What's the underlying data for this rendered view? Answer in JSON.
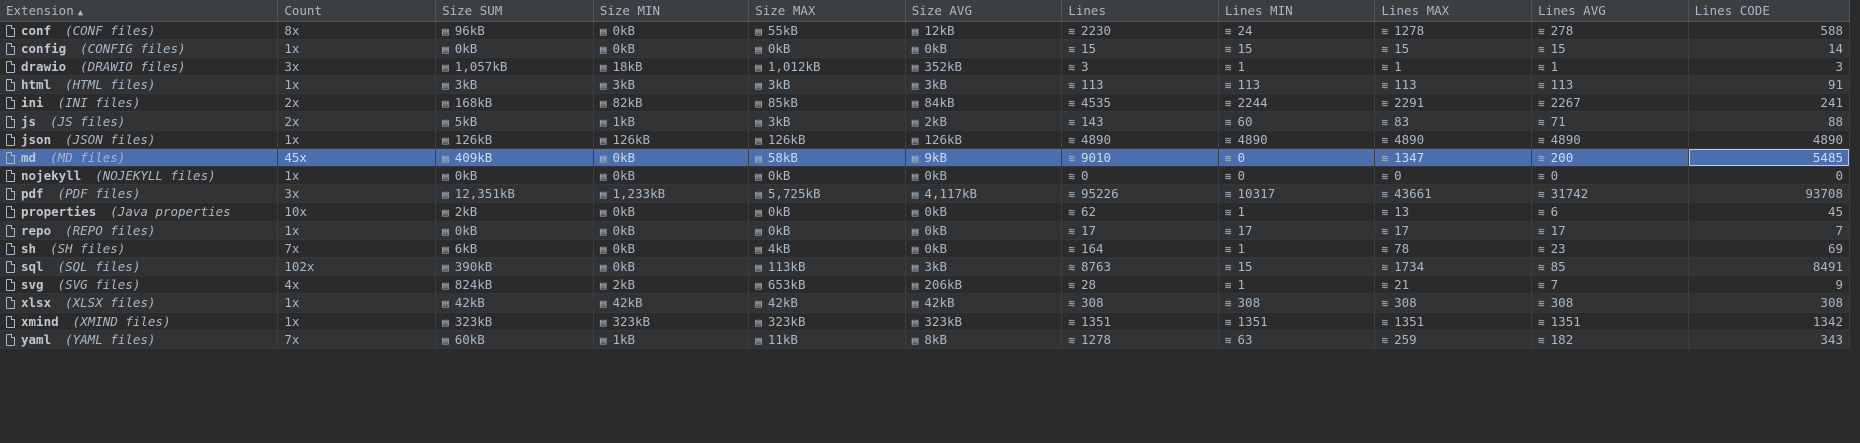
{
  "columns": [
    "Extension",
    "Count",
    "Size SUM",
    "Size MIN",
    "Size MAX",
    "Size AVG",
    "Lines",
    "Lines MIN",
    "Lines MAX",
    "Lines AVG",
    "Lines CODE"
  ],
  "sort": {
    "column": "Extension",
    "direction": "ascending",
    "icon": "sort-ascending-icon"
  },
  "selected_row": "md",
  "rows": [
    {
      "ext": "conf",
      "desc": "(CONF files)",
      "count": "8x",
      "size_sum": "96kB",
      "size_min": "0kB",
      "size_max": "55kB",
      "size_avg": "12kB",
      "lines": "2230",
      "lines_min": "24",
      "lines_max": "1278",
      "lines_avg": "278",
      "lines_code": "588"
    },
    {
      "ext": "config",
      "desc": "(CONFIG files)",
      "count": "1x",
      "size_sum": "0kB",
      "size_min": "0kB",
      "size_max": "0kB",
      "size_avg": "0kB",
      "lines": "15",
      "lines_min": "15",
      "lines_max": "15",
      "lines_avg": "15",
      "lines_code": "14"
    },
    {
      "ext": "drawio",
      "desc": "(DRAWIO files)",
      "count": "3x",
      "size_sum": "1,057kB",
      "size_min": "18kB",
      "size_max": "1,012kB",
      "size_avg": "352kB",
      "lines": "3",
      "lines_min": "1",
      "lines_max": "1",
      "lines_avg": "1",
      "lines_code": "3"
    },
    {
      "ext": "html",
      "desc": "(HTML files)",
      "count": "1x",
      "size_sum": "3kB",
      "size_min": "3kB",
      "size_max": "3kB",
      "size_avg": "3kB",
      "lines": "113",
      "lines_min": "113",
      "lines_max": "113",
      "lines_avg": "113",
      "lines_code": "91"
    },
    {
      "ext": "ini",
      "desc": "(INI files)",
      "count": "2x",
      "size_sum": "168kB",
      "size_min": "82kB",
      "size_max": "85kB",
      "size_avg": "84kB",
      "lines": "4535",
      "lines_min": "2244",
      "lines_max": "2291",
      "lines_avg": "2267",
      "lines_code": "241"
    },
    {
      "ext": "js",
      "desc": "(JS files)",
      "count": "2x",
      "size_sum": "5kB",
      "size_min": "1kB",
      "size_max": "3kB",
      "size_avg": "2kB",
      "lines": "143",
      "lines_min": "60",
      "lines_max": "83",
      "lines_avg": "71",
      "lines_code": "88"
    },
    {
      "ext": "json",
      "desc": "(JSON files)",
      "count": "1x",
      "size_sum": "126kB",
      "size_min": "126kB",
      "size_max": "126kB",
      "size_avg": "126kB",
      "lines": "4890",
      "lines_min": "4890",
      "lines_max": "4890",
      "lines_avg": "4890",
      "lines_code": "4890"
    },
    {
      "ext": "md",
      "desc": "(MD files)",
      "count": "45x",
      "size_sum": "409kB",
      "size_min": "0kB",
      "size_max": "58kB",
      "size_avg": "9kB",
      "lines": "9010",
      "lines_min": "0",
      "lines_max": "1347",
      "lines_avg": "200",
      "lines_code": "5485"
    },
    {
      "ext": "nojekyll",
      "desc": "(NOJEKYLL files)",
      "count": "1x",
      "size_sum": "0kB",
      "size_min": "0kB",
      "size_max": "0kB",
      "size_avg": "0kB",
      "lines": "0",
      "lines_min": "0",
      "lines_max": "0",
      "lines_avg": "0",
      "lines_code": "0"
    },
    {
      "ext": "pdf",
      "desc": "(PDF files)",
      "count": "3x",
      "size_sum": "12,351kB",
      "size_min": "1,233kB",
      "size_max": "5,725kB",
      "size_avg": "4,117kB",
      "lines": "95226",
      "lines_min": "10317",
      "lines_max": "43661",
      "lines_avg": "31742",
      "lines_code": "93708"
    },
    {
      "ext": "properties",
      "desc": "(Java properties",
      "count": "10x",
      "size_sum": "2kB",
      "size_min": "0kB",
      "size_max": "0kB",
      "size_avg": "0kB",
      "lines": "62",
      "lines_min": "1",
      "lines_max": "13",
      "lines_avg": "6",
      "lines_code": "45"
    },
    {
      "ext": "repo",
      "desc": "(REPO files)",
      "count": "1x",
      "size_sum": "0kB",
      "size_min": "0kB",
      "size_max": "0kB",
      "size_avg": "0kB",
      "lines": "17",
      "lines_min": "17",
      "lines_max": "17",
      "lines_avg": "17",
      "lines_code": "7"
    },
    {
      "ext": "sh",
      "desc": "(SH files)",
      "count": "7x",
      "size_sum": "6kB",
      "size_min": "0kB",
      "size_max": "4kB",
      "size_avg": "0kB",
      "lines": "164",
      "lines_min": "1",
      "lines_max": "78",
      "lines_avg": "23",
      "lines_code": "69"
    },
    {
      "ext": "sql",
      "desc": "(SQL files)",
      "count": "102x",
      "size_sum": "390kB",
      "size_min": "0kB",
      "size_max": "113kB",
      "size_avg": "3kB",
      "lines": "8763",
      "lines_min": "15",
      "lines_max": "1734",
      "lines_avg": "85",
      "lines_code": "8491"
    },
    {
      "ext": "svg",
      "desc": "(SVG files)",
      "count": "4x",
      "size_sum": "824kB",
      "size_min": "2kB",
      "size_max": "653kB",
      "size_avg": "206kB",
      "lines": "28",
      "lines_min": "1",
      "lines_max": "21",
      "lines_avg": "7",
      "lines_code": "9"
    },
    {
      "ext": "xlsx",
      "desc": "(XLSX files)",
      "count": "1x",
      "size_sum": "42kB",
      "size_min": "42kB",
      "size_max": "42kB",
      "size_avg": "42kB",
      "lines": "308",
      "lines_min": "308",
      "lines_max": "308",
      "lines_avg": "308",
      "lines_code": "308"
    },
    {
      "ext": "xmind",
      "desc": "(XMIND files)",
      "count": "1x",
      "size_sum": "323kB",
      "size_min": "323kB",
      "size_max": "323kB",
      "size_avg": "323kB",
      "lines": "1351",
      "lines_min": "1351",
      "lines_max": "1351",
      "lines_avg": "1351",
      "lines_code": "1342"
    },
    {
      "ext": "yaml",
      "desc": "(YAML files)",
      "count": "7x",
      "size_sum": "60kB",
      "size_min": "1kB",
      "size_max": "11kB",
      "size_avg": "8kB",
      "lines": "1278",
      "lines_min": "63",
      "lines_max": "259",
      "lines_avg": "182",
      "lines_code": "343"
    }
  ],
  "icons": {
    "file": "file-icon",
    "size": "size-file-icon",
    "lines": "lines-stack-icon"
  },
  "colors": {
    "background": "#2b2b2b",
    "row_alt": "#313335",
    "header": "#3c3f41",
    "selection": "#4b6eaf",
    "text": "#a9b7c6"
  }
}
